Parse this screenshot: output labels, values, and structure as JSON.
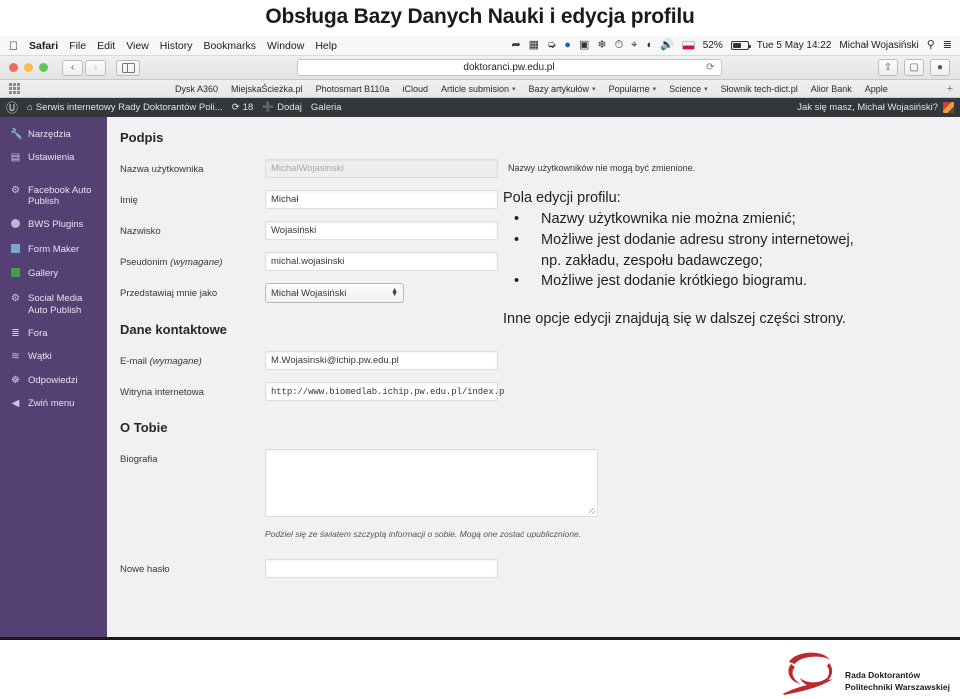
{
  "slide": {
    "title": "Obsługa Bazy Danych Nauki i edycja profilu"
  },
  "mac_menubar": {
    "apple_icon": "apple-icon",
    "app_name": "Safari",
    "menus": [
      "File",
      "Edit",
      "View",
      "History",
      "Bookmarks",
      "Window",
      "Help"
    ],
    "status_icons": [
      "dropbox-icon",
      "vault-icon",
      "fast-forward-icon",
      "globe-icon",
      "display-icon",
      "flower-icon",
      "clock-icon",
      "bluetooth-icon",
      "wifi-icon",
      "volume-icon"
    ],
    "input_flag": "polish-flag-icon",
    "battery_percent": "52%",
    "battery_fill": 52,
    "clock": "Tue 5 May  14:22",
    "user": "Michał Wojasiński",
    "search_icon": "search-icon",
    "control_center_icon": "list-icon"
  },
  "safari_toolbar": {
    "back_icon": "chevron-left-icon",
    "forward_icon": "chevron-right-icon",
    "sidebar_icon": "sidebar-icon",
    "url": "doktoranci.pw.edu.pl",
    "reload_icon": "reload-icon",
    "share_icon": "share-icon",
    "tabs_icon": "tabs-icon",
    "downloads_icon": "downloads-icon"
  },
  "bookmarks_bar": {
    "apps_icon": "apps-grid-icon",
    "plus_icon": "plus-icon",
    "items": [
      {
        "label": "Dysk A360",
        "has_caret": false
      },
      {
        "label": "MiejskaŚcieżka.pl",
        "has_caret": false
      },
      {
        "label": "Photosmart B110a",
        "has_caret": false
      },
      {
        "label": "iCloud",
        "has_caret": false
      },
      {
        "label": "Article submision",
        "has_caret": true
      },
      {
        "label": "Bazy artykułów",
        "has_caret": true
      },
      {
        "label": "Popularne",
        "has_caret": true
      },
      {
        "label": "Science",
        "has_caret": true
      },
      {
        "label": "Słownik tech-dict.pl",
        "has_caret": false
      },
      {
        "label": "Alior Bank",
        "has_caret": false
      },
      {
        "label": "Apple",
        "has_caret": false
      }
    ]
  },
  "wp_adminbar": {
    "wp_logo": "wordpress-logo-icon",
    "site_icon": "home-icon",
    "site_name": "Serwis internetowy Rady Doktorantów Poli...",
    "updates_icon": "updates-icon",
    "updates_count": "18",
    "new_icon": "plus-icon",
    "new_label": "Dodaj",
    "gallery_label": "Galeria",
    "greeting": "Jak się masz, Michał Wojasiński?",
    "avatar": "user-avatar"
  },
  "sidebar": {
    "items": [
      {
        "label": "Narzędzia",
        "icon": "wrench-icon",
        "type": "glyph",
        "glyph": "🔧"
      },
      {
        "label": "Ustawienia",
        "icon": "settings-sliders-icon",
        "type": "glyph",
        "glyph": "▤"
      },
      {
        "label": "Facebook Auto Publish",
        "icon": "gear-icon",
        "type": "glyph",
        "glyph": "⚙"
      },
      {
        "label": "BWS Plugins",
        "icon": "bws-circle-icon",
        "type": "shape",
        "shape": "gray"
      },
      {
        "label": "Form Maker",
        "icon": "form-icon",
        "type": "shape",
        "shape": "blue"
      },
      {
        "label": "Gallery",
        "icon": "gallery-square-icon",
        "type": "shape",
        "shape": "green"
      },
      {
        "label": "Social Media Auto Publish",
        "icon": "gear-icon",
        "type": "glyph",
        "glyph": "⚙"
      },
      {
        "label": "Fora",
        "icon": "forums-icon",
        "type": "glyph",
        "glyph": "☰"
      },
      {
        "label": "Wątki",
        "icon": "topics-icon",
        "type": "glyph",
        "glyph": "≋"
      },
      {
        "label": "Odpowiedzi",
        "icon": "replies-icon",
        "type": "glyph",
        "glyph": "⌘"
      },
      {
        "label": "Zwiń menu",
        "icon": "collapse-icon",
        "type": "glyph",
        "glyph": "◀"
      }
    ]
  },
  "profile": {
    "sections": {
      "signature": "Podpis",
      "contact": "Dane kontaktowe",
      "about": "O Tobie"
    },
    "fields": {
      "username": {
        "label": "Nazwa użytkownika",
        "value": "MichalWojasinski",
        "disabled": true,
        "note": "Nazwy użytkowników nie mogą być zmienione."
      },
      "first_name": {
        "label": "Imię",
        "value": "Michał"
      },
      "last_name": {
        "label": "Nazwisko",
        "value": "Wojasiński"
      },
      "nickname": {
        "label": "Pseudonim",
        "label_req": "(wymagane)",
        "value": "michal.wojasinski"
      },
      "display_name": {
        "label": "Przedstawiaj mnie jako",
        "value": "Michał Wojasiński"
      },
      "email": {
        "label": "E-mail",
        "label_req": "(wymagane)",
        "value": "M.Wojasinski@ichip.pw.edu.pl"
      },
      "website": {
        "label": "Witryna internetowa",
        "value": "http://www.biomedlab.ichip.pw.edu.pl/index.p"
      },
      "bio": {
        "label": "Biografia",
        "value": "",
        "hint": "Podziel się ze światem szczyptą informacji o sobie. Mogą one zostać upublicznione."
      },
      "new_password": {
        "label": "Nowe hasło",
        "value": ""
      }
    }
  },
  "annotation": {
    "heading": "Pola edycji profilu:",
    "bullets": [
      {
        "bullet": "•",
        "text": "Nazwy użytkownika nie można zmienić;"
      },
      {
        "bullet": "•",
        "text": "Możliwe jest dodanie adresu strony internetowej,",
        "cont": "np. zakładu, zespołu badawczego;"
      },
      {
        "bullet": "•",
        "text": "Możliwe jest dodanie krótkiego biogramu."
      }
    ],
    "footer": "Inne opcje edycji znajdują się w dalszej części strony."
  },
  "footer": {
    "logo_icon": "rada-doktorantow-logo-icon",
    "logo_line1": "Rada Doktorantów",
    "logo_line2": "Politechniki Warszawskiej"
  },
  "colors": {
    "wp_sidebar": "#554073",
    "wp_adminbar": "#32373c",
    "content_bg": "#f1f1f1",
    "logo_red": "#c0282d"
  }
}
